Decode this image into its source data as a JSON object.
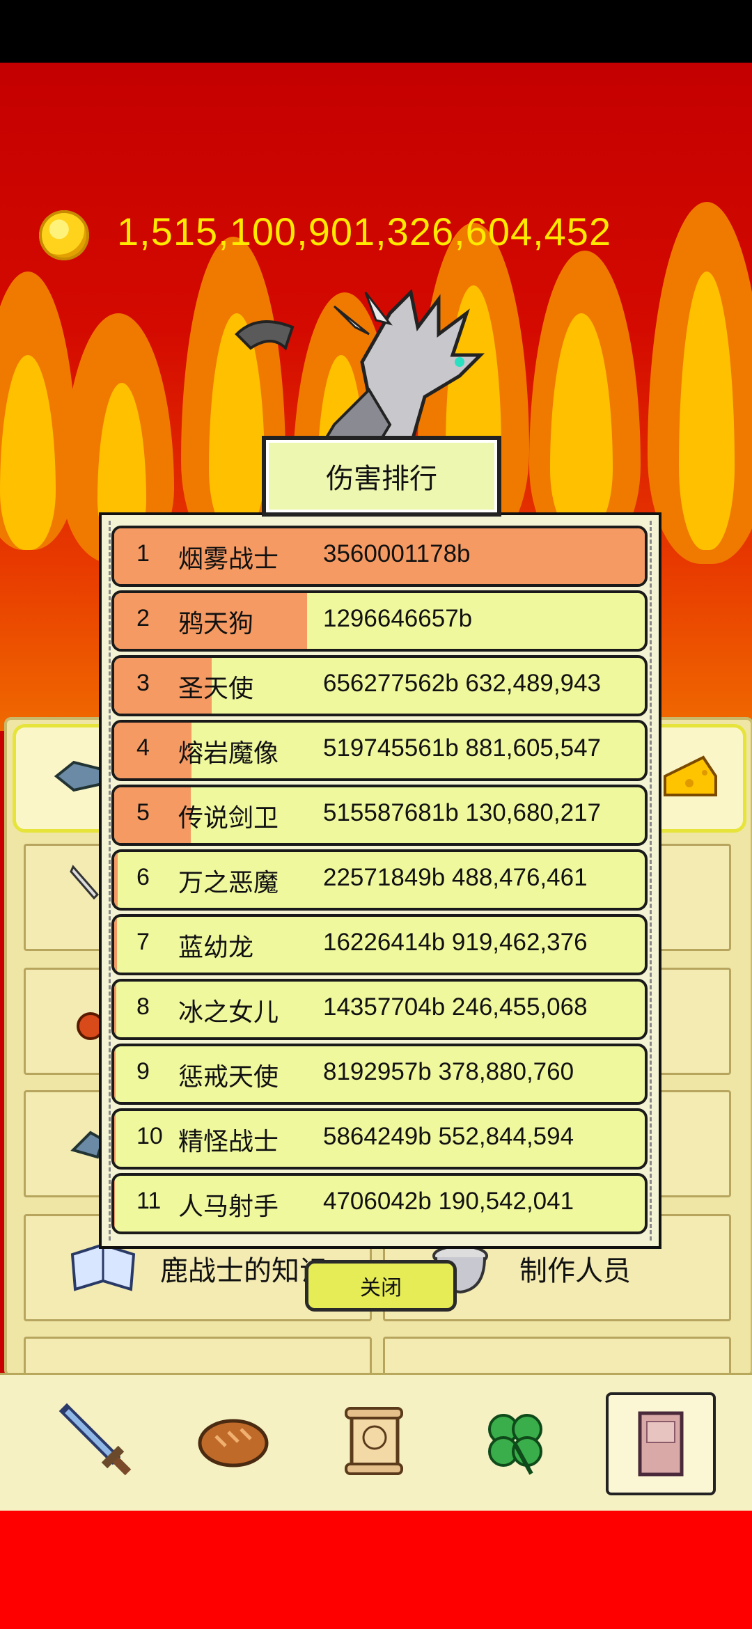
{
  "currency": {
    "icon": "gold-coin-icon",
    "amount": "1,515,100,901,326,604,452"
  },
  "dialog": {
    "title": "伤害排行",
    "close_label": "关闭",
    "rows": [
      {
        "rank": "1",
        "name": "烟雾战士",
        "score": "3560001178b",
        "fill": 1.0
      },
      {
        "rank": "2",
        "name": "鸦天狗",
        "score": "1296646657b",
        "fill": 0.364
      },
      {
        "rank": "3",
        "name": "圣天使",
        "score": "656277562b 632,489,943",
        "fill": 0.184
      },
      {
        "rank": "4",
        "name": "熔岩魔像",
        "score": "519745561b 881,605,547",
        "fill": 0.146
      },
      {
        "rank": "5",
        "name": "传说剑卫",
        "score": "515587681b 130,680,217",
        "fill": 0.145
      },
      {
        "rank": "6",
        "name": "万之恶魔",
        "score": "22571849b 488,476,461",
        "fill": 0.006
      },
      {
        "rank": "7",
        "name": "蓝幼龙",
        "score": "16226414b 919,462,376",
        "fill": 0.005
      },
      {
        "rank": "8",
        "name": "冰之女儿",
        "score": "14357704b 246,455,068",
        "fill": 0.004
      },
      {
        "rank": "9",
        "name": "惩戒天使",
        "score": "8192957b 378,880,760",
        "fill": 0.002
      },
      {
        "rank": "10",
        "name": "精怪战士",
        "score": "5864249b 552,844,594",
        "fill": 0.002
      },
      {
        "rank": "11",
        "name": "人马射手",
        "score": "4706042b 190,542,041",
        "fill": 0.001
      }
    ]
  },
  "background_menu": {
    "item_knowledge": "鹿战士的知识",
    "item_credits": "制作人员"
  },
  "bottom_nav": {
    "tabs": [
      {
        "icon": "sword-icon"
      },
      {
        "icon": "bread-icon"
      },
      {
        "icon": "scroll-icon"
      },
      {
        "icon": "clover-icon"
      },
      {
        "icon": "book-icon",
        "selected": true
      }
    ]
  },
  "colors": {
    "bar_fill": "#f59a63",
    "row_bg": "#f0f89e",
    "coin_text": "#ffea00",
    "fire_red": "#c80000"
  }
}
